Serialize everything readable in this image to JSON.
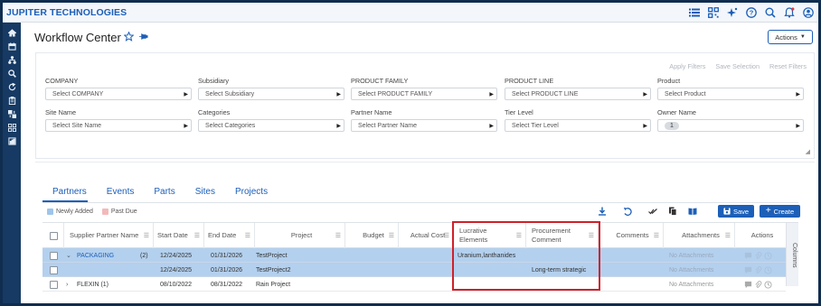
{
  "app": {
    "brand": "JUPITER TECHNOLOGIES"
  },
  "topbar": {
    "icons": [
      "list-icon",
      "qr-icon",
      "sparkle-icon",
      "help-icon",
      "search-icon",
      "bell-icon",
      "user-icon"
    ]
  },
  "rail": {
    "icons": [
      "home-icon",
      "calendar-icon",
      "hierarchy-icon",
      "search-icon",
      "refresh-icon",
      "clipboard-icon",
      "transfer-icon",
      "grid-icon",
      "report-icon"
    ]
  },
  "page": {
    "title": "Workflow Center",
    "actions_label": "Actions"
  },
  "filters": {
    "links": {
      "apply": "Apply Filters",
      "save": "Save Selection",
      "reset": "Reset Filters"
    },
    "fields": [
      {
        "label": "COMPANY",
        "placeholder": "Select COMPANY"
      },
      {
        "label": "Subsidiary",
        "placeholder": "Select Subsidiary"
      },
      {
        "label": "PRODUCT FAMILY",
        "placeholder": "Select PRODUCT FAMILY"
      },
      {
        "label": "PRODUCT LINE",
        "placeholder": "Select PRODUCT LINE"
      },
      {
        "label": "Product",
        "placeholder": "Select Product"
      },
      {
        "label": "Site Name",
        "placeholder": "Select Site Name"
      },
      {
        "label": "Categories",
        "placeholder": "Select Categories"
      },
      {
        "label": "Partner Name",
        "placeholder": "Select Partner Name"
      },
      {
        "label": "Tier Level",
        "placeholder": "Select Tier Level"
      },
      {
        "label": "Owner Name",
        "value": "1"
      }
    ]
  },
  "tabs": [
    "Partners",
    "Events",
    "Parts",
    "Sites",
    "Projects"
  ],
  "legend": {
    "newly_added": "Newly Added",
    "past_due": "Past Due",
    "newly_added_color": "#9ec5ea",
    "past_due_color": "#f3b9b9"
  },
  "toolbar": {
    "save_label": "Save",
    "create_label": "Create"
  },
  "grid": {
    "columns": [
      "Supplier Partner Name",
      "Start Date",
      "End Date",
      "Project",
      "Budget",
      "Actual Cost",
      "Lucrative Elements",
      "Procurement Comment",
      "Comments",
      "Attachments",
      "Actions"
    ],
    "side_label": "Columns",
    "rows": [
      {
        "name": "PACKAGING",
        "count": "(2)",
        "start": "12/24/2025",
        "end": "01/31/2026",
        "project": "TestProject",
        "lucrative": "Uranium,lanthanides",
        "comment": "",
        "attachments": "No Attachments"
      },
      {
        "name": "",
        "count": "",
        "start": "12/24/2025",
        "end": "01/31/2026",
        "project": "TestProject2",
        "lucrative": "",
        "comment": "Long-term strategic",
        "attachments": "No Attachments"
      },
      {
        "name": "FLEXIN (1)",
        "count": "",
        "start": "08/10/2022",
        "end": "08/31/2022",
        "project": "Rain Project",
        "lucrative": "",
        "comment": "",
        "attachments": "No Attachments"
      }
    ]
  }
}
